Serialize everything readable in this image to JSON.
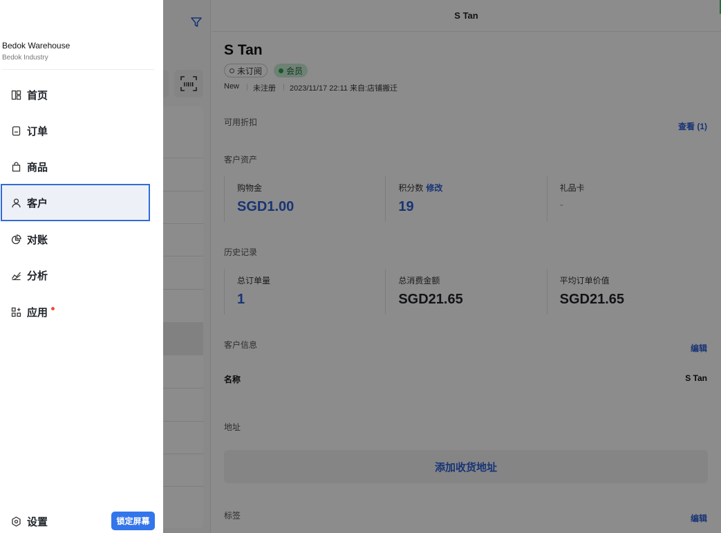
{
  "drawer": {
    "store_name": "Bedok Warehouse",
    "store_sub": "Bedok Industry",
    "nav": [
      {
        "label": "首页",
        "icon": "dashboard-icon"
      },
      {
        "label": "订单",
        "icon": "document-icon"
      },
      {
        "label": "商品",
        "icon": "shopping-bag-icon"
      },
      {
        "label": "客户",
        "icon": "user-icon",
        "active": true
      },
      {
        "label": "对账",
        "icon": "pie-chart-icon"
      },
      {
        "label": "分析",
        "icon": "area-chart-icon"
      },
      {
        "label": "应用",
        "icon": "apps-icon",
        "badge": "red-dot"
      }
    ],
    "settings_label": "设置",
    "lock_label": "锁定屏幕"
  },
  "detail": {
    "header_title": "S Tan",
    "customer_name": "S Tan",
    "tags": {
      "unsubscribed": "未订阅",
      "member": "会员"
    },
    "meta": {
      "status": "New",
      "registration": "未注册",
      "created": "2023/11/17 22:11 来自:店铺搬迁"
    },
    "discounts": {
      "title": "可用折扣",
      "link": "查看 (1)"
    },
    "assets": {
      "title": "客户资产",
      "cells": [
        {
          "label": "购物金",
          "value": "SGD1.00"
        },
        {
          "label": "积分数",
          "link": "修改",
          "value": "19"
        },
        {
          "label": "礼品卡",
          "value": "-"
        }
      ]
    },
    "history": {
      "title": "历史记录",
      "cells": [
        {
          "label": "总订单量",
          "value": "1"
        },
        {
          "label": "总消费金额",
          "value": "SGD21.65"
        },
        {
          "label": "平均订单价值",
          "value": "SGD21.65"
        }
      ]
    },
    "info": {
      "title": "客户信息",
      "edit": "编辑",
      "name_label": "名称",
      "name_value": "S Tan"
    },
    "address": {
      "title": "地址",
      "add_label": "添加收货地址"
    },
    "labels": {
      "title": "标签",
      "edit": "编辑"
    }
  },
  "colors": {
    "accent": "#2d5fd6",
    "lock_button": "#3375ea",
    "member_green": "#20a34a",
    "badge_red": "#f04b3a"
  }
}
